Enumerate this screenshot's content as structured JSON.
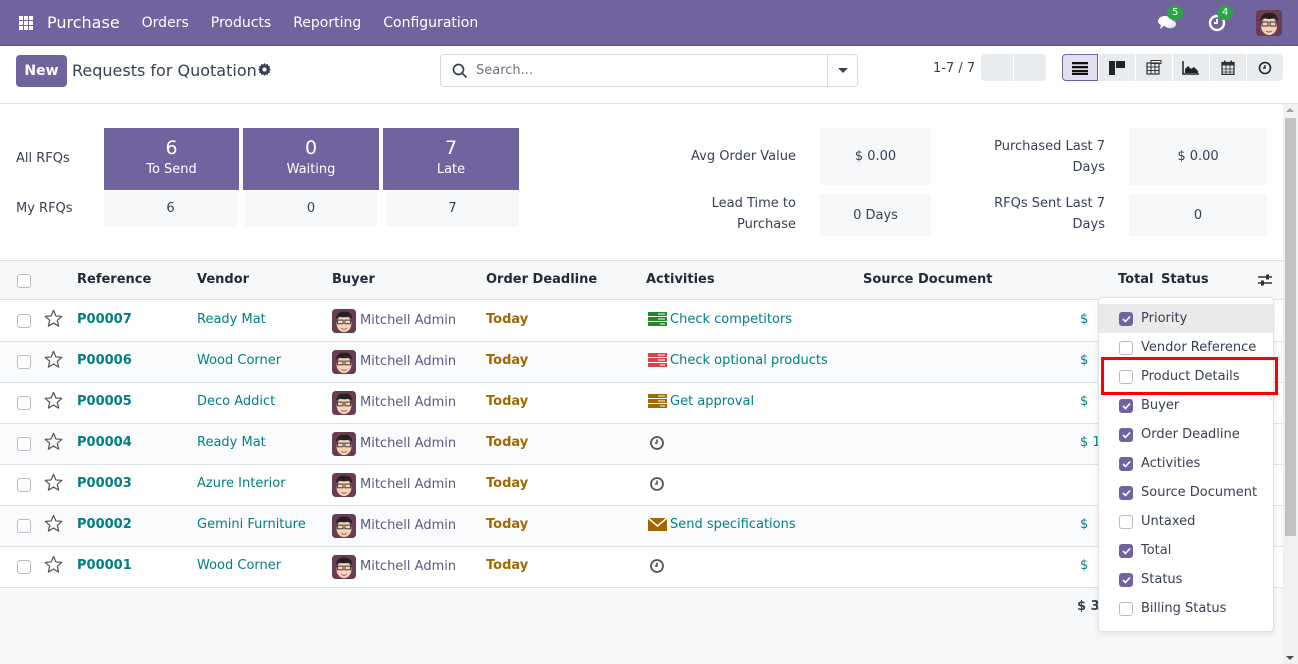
{
  "navbar": {
    "brand": "Purchase",
    "menu": [
      "Orders",
      "Products",
      "Reporting",
      "Configuration"
    ],
    "messages_count": "5",
    "activities_count": "4",
    "icons": {
      "apps": "apps-grid-icon",
      "messages": "chat-icon",
      "activities": "clock-icon",
      "avatar": "user-avatar"
    }
  },
  "control": {
    "new_label": "New",
    "title": "Requests for Quotation",
    "search_placeholder": "Search...",
    "search_value": "",
    "pager": "1-7 / 7",
    "views": [
      "list",
      "kanban",
      "pivot",
      "graph",
      "calendar",
      "activity"
    ],
    "active_view": "list"
  },
  "dashboard": {
    "all_label": "All RFQs",
    "my_label": "My RFQs",
    "tiles": [
      {
        "count": "6",
        "label": "To Send",
        "mine": "6"
      },
      {
        "count": "0",
        "label": "Waiting",
        "mine": "0"
      },
      {
        "count": "7",
        "label": "Late",
        "mine": "7"
      }
    ],
    "kpis": [
      {
        "label": "Avg Order Value",
        "value": "$ 0.00"
      },
      {
        "label": "Purchased Last 7 Days",
        "value": "$ 0.00"
      },
      {
        "label": "Lead Time to Purchase",
        "value": "0 Days"
      },
      {
        "label": "RFQs Sent Last 7 Days",
        "value": "0"
      }
    ]
  },
  "table": {
    "headers": {
      "reference": "Reference",
      "vendor": "Vendor",
      "buyer": "Buyer",
      "deadline": "Order Deadline",
      "activities": "Activities",
      "source": "Source Document",
      "total": "Total",
      "status": "Status"
    },
    "rows": [
      {
        "ref": "P00007",
        "vendor": "Ready Mat",
        "buyer": "Mitchell Admin",
        "deadline": "Today",
        "activity": "Check competitors",
        "activity_icon": "todo-green",
        "total": "$"
      },
      {
        "ref": "P00006",
        "vendor": "Wood Corner",
        "buyer": "Mitchell Admin",
        "deadline": "Today",
        "activity": "Check optional products",
        "activity_icon": "todo-red",
        "total": "$"
      },
      {
        "ref": "P00005",
        "vendor": "Deco Addict",
        "buyer": "Mitchell Admin",
        "deadline": "Today",
        "activity": "Get approval",
        "activity_icon": "todo-amber",
        "total": "$"
      },
      {
        "ref": "P00004",
        "vendor": "Ready Mat",
        "buyer": "Mitchell Admin",
        "deadline": "Today",
        "activity": "",
        "activity_icon": "clock",
        "total": "$ 1"
      },
      {
        "ref": "P00003",
        "vendor": "Azure Interior",
        "buyer": "Mitchell Admin",
        "deadline": "Today",
        "activity": "",
        "activity_icon": "clock",
        "total": ""
      },
      {
        "ref": "P00002",
        "vendor": "Gemini Furniture",
        "buyer": "Mitchell Admin",
        "deadline": "Today",
        "activity": "Send specifications",
        "activity_icon": "email-amber",
        "total": "$"
      },
      {
        "ref": "P00001",
        "vendor": "Wood Corner",
        "buyer": "Mitchell Admin",
        "deadline": "Today",
        "activity": "",
        "activity_icon": "clock",
        "total": "$"
      }
    ],
    "footer_total": "$ 3"
  },
  "column_menu": {
    "items": [
      {
        "label": "Priority",
        "checked": true
      },
      {
        "label": "Vendor Reference",
        "checked": false
      },
      {
        "label": "Product Details",
        "checked": false
      },
      {
        "label": "Buyer",
        "checked": true
      },
      {
        "label": "Order Deadline",
        "checked": true
      },
      {
        "label": "Activities",
        "checked": true
      },
      {
        "label": "Source Document",
        "checked": true
      },
      {
        "label": "Untaxed",
        "checked": false
      },
      {
        "label": "Total",
        "checked": true
      },
      {
        "label": "Status",
        "checked": true
      },
      {
        "label": "Billing Status",
        "checked": false
      }
    ],
    "highlighted": "Product Details"
  },
  "colors": {
    "brand": "#71639e",
    "link": "#017e84",
    "deadline": "#a06800",
    "badge": "#28a745",
    "highlight": "#ff0000"
  }
}
